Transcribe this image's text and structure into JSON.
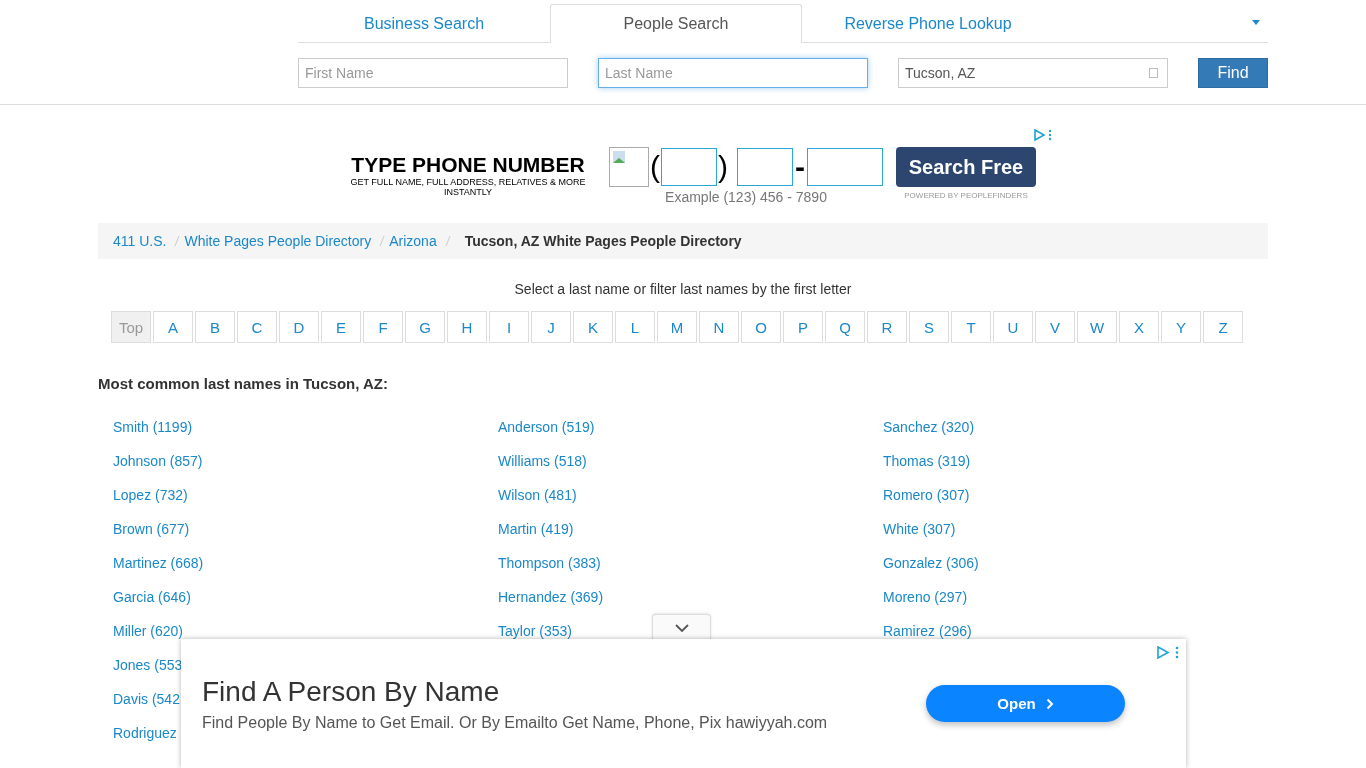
{
  "tabs": [
    {
      "label": "Business Search",
      "selected": false
    },
    {
      "label": "People Search",
      "selected": true
    },
    {
      "label": "Reverse Phone Lookup",
      "selected": false
    }
  ],
  "search": {
    "fields": [
      {
        "placeholder": "First Name",
        "focused": false
      },
      {
        "placeholder": "Last Name",
        "focused": true
      },
      {
        "value": "Tucson, AZ",
        "focused": false
      }
    ],
    "button": "Find"
  },
  "phone_ad": {
    "title": "TYPE PHONE NUMBER",
    "subtitle": "GET FULL NAME, FULL ADDRESS, RELATIVES & MORE INSTANTLY",
    "open_paren": "(",
    "close_paren": ")",
    "dash": "-",
    "example": "Example (123) 456 - 7890",
    "button": "Search Free",
    "powered_by": "POWERED BY PEOPLEFINDERS"
  },
  "breadcrumb": [
    {
      "label": "411 U.S.",
      "current": false
    },
    {
      "label": "White Pages People Directory",
      "current": false
    },
    {
      "label": "Arizona",
      "current": false
    },
    {
      "label": "Tucson, AZ White Pages People Directory",
      "current": true
    }
  ],
  "letter_filter": {
    "prompt": "Select a last name or filter last names by the first letter",
    "letters": [
      {
        "label": "Top",
        "selected": true
      },
      {
        "label": "A",
        "selected": false
      },
      {
        "label": "B",
        "selected": false
      },
      {
        "label": "C",
        "selected": false
      },
      {
        "label": "D",
        "selected": false
      },
      {
        "label": "E",
        "selected": false
      },
      {
        "label": "F",
        "selected": false
      },
      {
        "label": "G",
        "selected": false
      },
      {
        "label": "H",
        "selected": false
      },
      {
        "label": "I",
        "selected": false
      },
      {
        "label": "J",
        "selected": false
      },
      {
        "label": "K",
        "selected": false
      },
      {
        "label": "L",
        "selected": false
      },
      {
        "label": "M",
        "selected": false
      },
      {
        "label": "N",
        "selected": false
      },
      {
        "label": "O",
        "selected": false
      },
      {
        "label": "P",
        "selected": false
      },
      {
        "label": "Q",
        "selected": false
      },
      {
        "label": "R",
        "selected": false
      },
      {
        "label": "S",
        "selected": false
      },
      {
        "label": "T",
        "selected": false
      },
      {
        "label": "U",
        "selected": false
      },
      {
        "label": "V",
        "selected": false
      },
      {
        "label": "W",
        "selected": false
      },
      {
        "label": "X",
        "selected": false
      },
      {
        "label": "Y",
        "selected": false
      },
      {
        "label": "Z",
        "selected": false
      }
    ]
  },
  "heading": "Most common last names in Tucson, AZ:",
  "name_columns": [
    [
      "Smith (1199)",
      "Johnson (857)",
      "Lopez (732)",
      "Brown (677)",
      "Martinez (668)",
      "Garcia (646)",
      "Miller (620)",
      "Jones (553",
      "Davis (542",
      "Rodriguez"
    ],
    [
      "Anderson (519)",
      "Williams (518)",
      "Wilson (481)",
      "Martin (419)",
      "Thompson (383)",
      "Hernandez (369)",
      "Taylor (353)"
    ],
    [
      "Sanchez (320)",
      "Thomas (319)",
      "Romero (307)",
      "White (307)",
      "Gonzalez (306)",
      "Moreno (297)",
      "Ramirez (296)"
    ]
  ],
  "bottom_ad": {
    "title": "Find A Person By Name",
    "text": "Find People By Name to Get Email. Or By Emailto Get Name, Phone, Pix hawiyyah.com",
    "button": "Open"
  }
}
